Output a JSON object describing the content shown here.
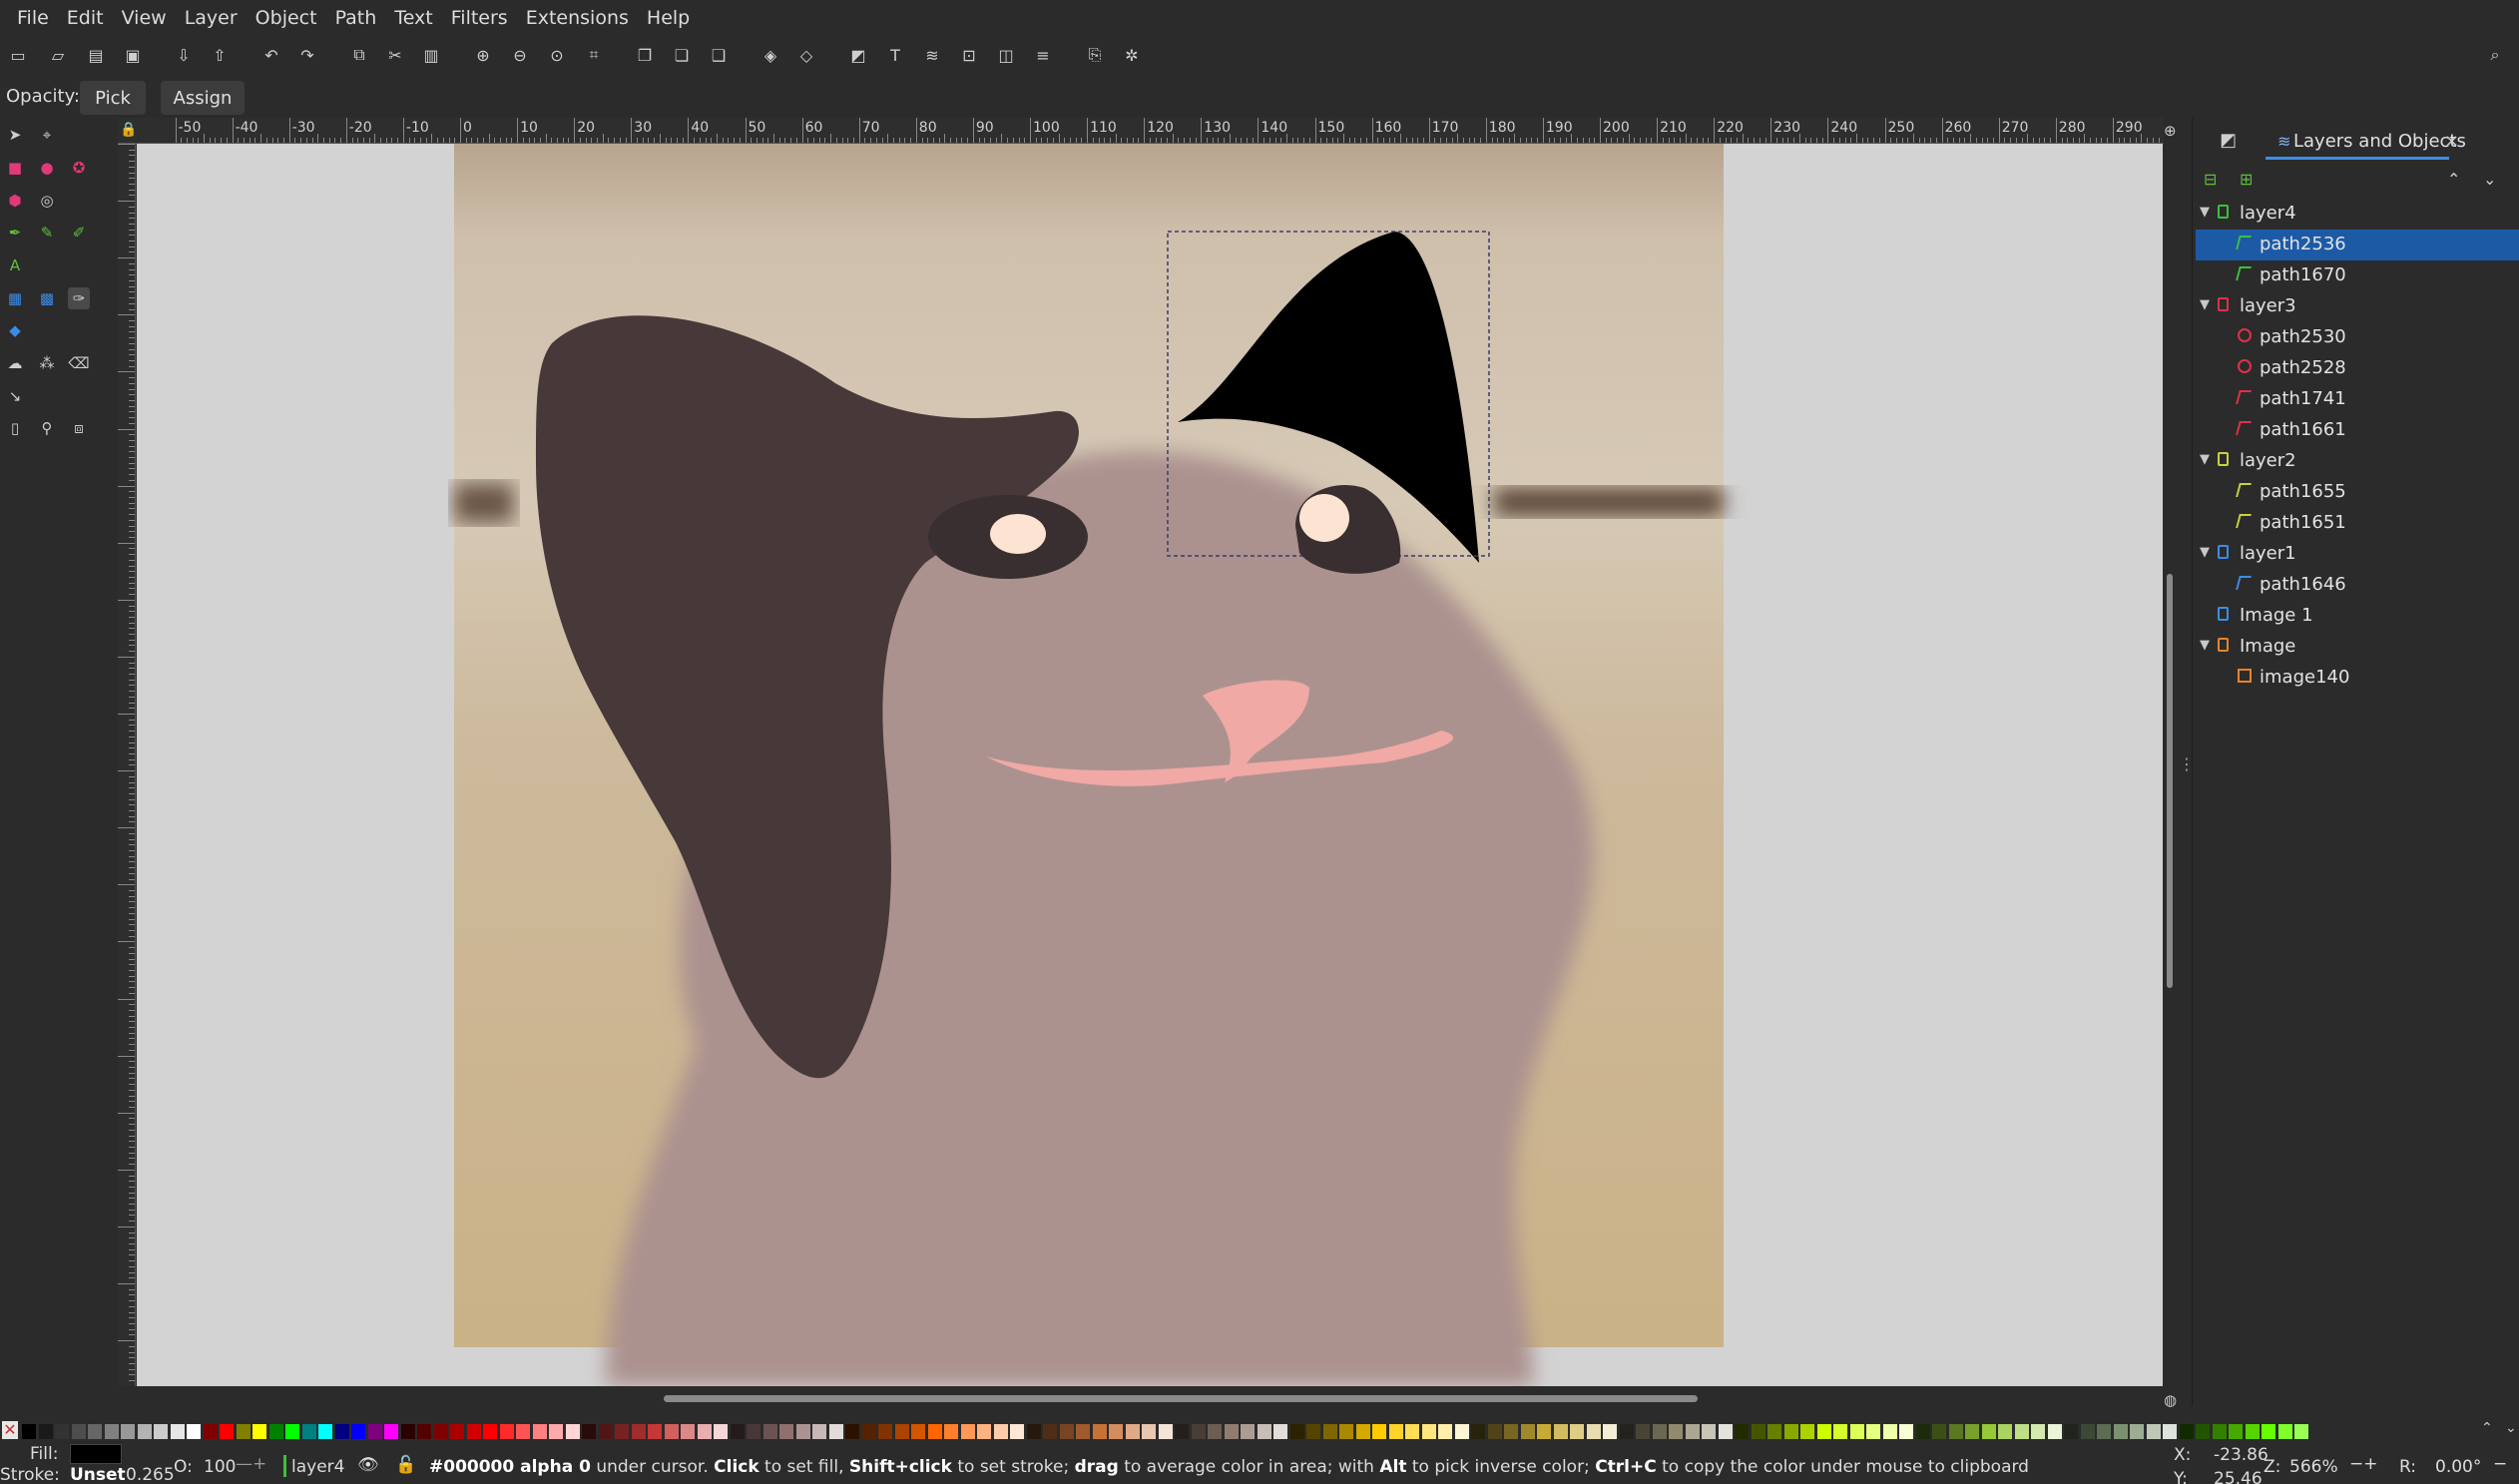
{
  "menu": [
    "File",
    "Edit",
    "View",
    "Layer",
    "Object",
    "Path",
    "Text",
    "Filters",
    "Extensions",
    "Help"
  ],
  "tool_controls": {
    "opacity_label": "Opacity:",
    "pick_label": "Pick",
    "assign_label": "Assign"
  },
  "ruler_labels": [
    "-50",
    "-40",
    "-30",
    "-20",
    "-10",
    "0",
    "10",
    "20",
    "30",
    "40",
    "50",
    "60",
    "70",
    "80",
    "90",
    "100",
    "110",
    "120",
    "130",
    "140",
    "150",
    "160",
    "170",
    "180",
    "190",
    "200",
    "210",
    "220",
    "230",
    "240",
    "250",
    "260",
    "270",
    "280",
    "290",
    "30"
  ],
  "dock": {
    "tab_label": "Layers and Objects",
    "close_glyph": "×"
  },
  "layers": [
    {
      "label": "layer4",
      "kind": "layer",
      "color": "#3fbf3f",
      "expanded": true
    },
    {
      "label": "path2536",
      "kind": "path",
      "color": "#3fbf3f",
      "selected": true
    },
    {
      "label": "path1670",
      "kind": "path",
      "color": "#3fbf3f"
    },
    {
      "label": "layer3",
      "kind": "layer",
      "color": "#e0304a",
      "expanded": true
    },
    {
      "label": "path2530",
      "kind": "circle",
      "color": "#e0304a"
    },
    {
      "label": "path2528",
      "kind": "circle",
      "color": "#e0304a"
    },
    {
      "label": "path1741",
      "kind": "path",
      "color": "#e0304a"
    },
    {
      "label": "path1661",
      "kind": "path",
      "color": "#e0304a"
    },
    {
      "label": "layer2",
      "kind": "layer",
      "color": "#c8d23c",
      "expanded": true
    },
    {
      "label": "path1655",
      "kind": "path",
      "color": "#c8d23c"
    },
    {
      "label": "path1651",
      "kind": "path",
      "color": "#c8d23c"
    },
    {
      "label": "layer1",
      "kind": "layer",
      "color": "#3c8ce6",
      "expanded": true
    },
    {
      "label": "path1646",
      "kind": "path",
      "color": "#3c8ce6"
    },
    {
      "label": "Image 1",
      "kind": "layer",
      "color": "#3c8ce6"
    },
    {
      "label": "Image",
      "kind": "layer",
      "color": "#e6822d",
      "expanded": true
    },
    {
      "label": "image140",
      "kind": "image",
      "color": "#e6822d"
    }
  ],
  "status": {
    "fill_label": "Fill:",
    "stroke_label": "Stroke:",
    "stroke_value": "Unset",
    "stroke_width": "0.265",
    "opacity_label": "O:",
    "opacity_value": "100",
    "layer_name": "layer4",
    "message_color": "#000000 alpha 0",
    "message_part1": " under cursor. ",
    "click": "Click",
    "message_part2": " to set fill, ",
    "shift_click": "Shift+click",
    "message_part3": " to set stroke; ",
    "drag": "drag",
    "message_part4": " to average color in area; with ",
    "alt": "Alt",
    "message_part5": " to pick inverse color; ",
    "ctrl_c": "Ctrl+C",
    "message_part6": " to copy the color under mouse to clipboard",
    "x_label": "X:",
    "x_value": "-23.86",
    "y_label": "Y:",
    "y_value": "25.46",
    "zoom_label": "Z:",
    "zoom_value": "566%",
    "rotation_label": "R:",
    "rotation_value": "0.00°"
  },
  "colors": {
    "fill": "#000000",
    "selection": "#1d5aa6",
    "ear_dark": "#47383a",
    "body": "#ab928f",
    "nose": "#f0a9a5",
    "eye_dark": "#3a2f30",
    "eye_highlight": "#fde3d2"
  }
}
